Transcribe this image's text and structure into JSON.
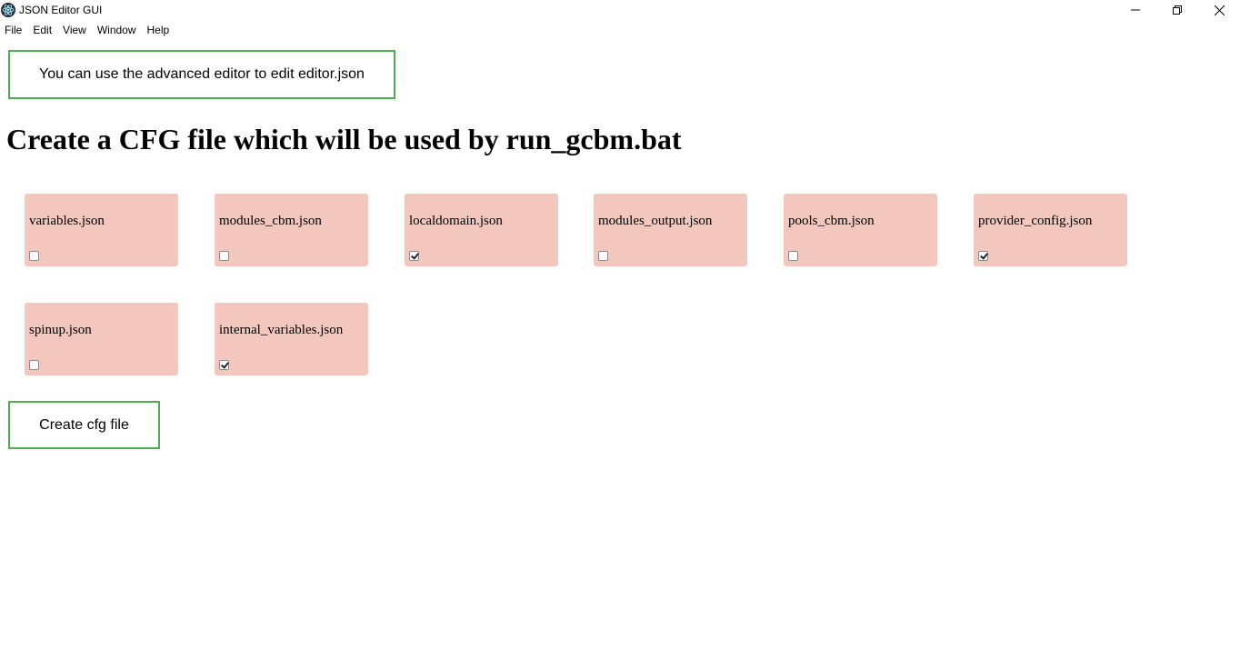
{
  "window": {
    "title": "JSON Editor GUI",
    "icon": "electron-atom-icon"
  },
  "menu": {
    "items": [
      "File",
      "Edit",
      "View",
      "Window",
      "Help"
    ]
  },
  "notice_button": {
    "label": "You can use the advanced editor to edit editor.json"
  },
  "heading": "Create a CFG file which will be used by run_gcbm.bat",
  "cards": [
    {
      "label": "variables.json",
      "checked": false
    },
    {
      "label": "modules_cbm.json",
      "checked": false
    },
    {
      "label": "localdomain.json",
      "checked": true
    },
    {
      "label": "modules_output.json",
      "checked": false
    },
    {
      "label": "pools_cbm.json",
      "checked": false
    },
    {
      "label": "provider_config.json",
      "checked": true
    },
    {
      "label": "spinup.json",
      "checked": false
    },
    {
      "label": "internal_variables.json",
      "checked": true
    }
  ],
  "create_button": {
    "label": "Create cfg file"
  },
  "colors": {
    "card_background": "#f3c7bd",
    "button_border": "#4caf50"
  }
}
